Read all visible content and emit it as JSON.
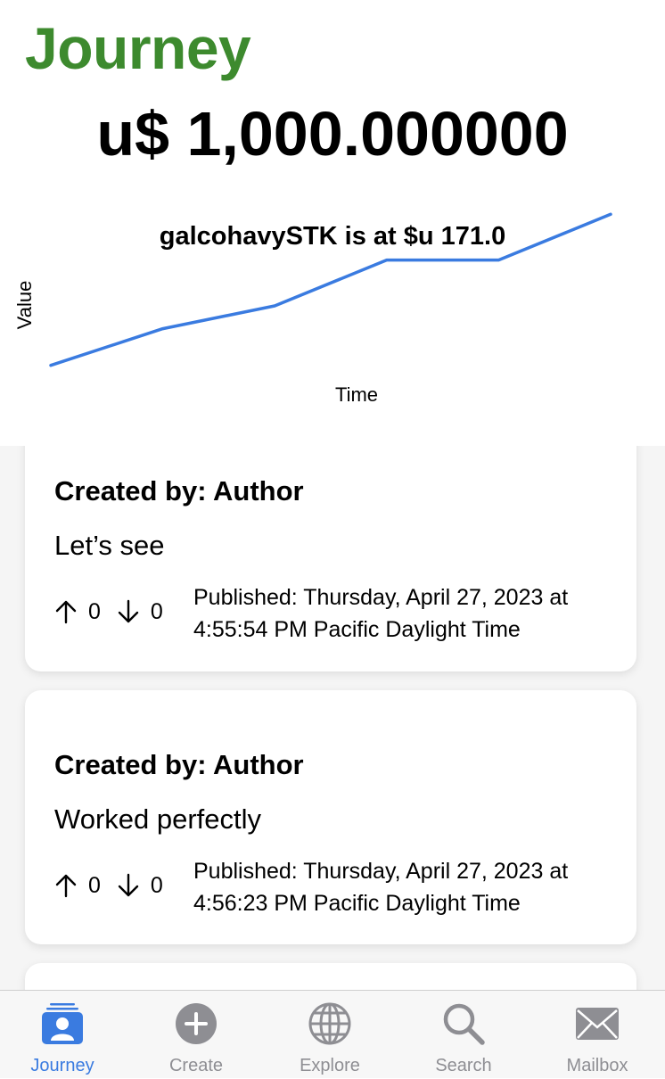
{
  "header": {
    "title": "Journey",
    "balance": "u$ 1,000.000000"
  },
  "chart": {
    "title": "galcohavySTK is at $u 171.0",
    "line_color": "#3a7be0"
  },
  "chart_data": {
    "type": "line",
    "title": "galcohavySTK is at $u 171.0",
    "xlabel": "Time",
    "ylabel": "Value",
    "x": [
      1,
      2,
      3,
      4,
      5,
      6
    ],
    "series": [
      {
        "values": [
          130,
          138,
          143,
          153,
          153,
          163
        ]
      }
    ],
    "ylim": [
      128,
      165
    ],
    "grid": false,
    "color": "#3a7be0"
  },
  "posts": [
    {
      "author": "Created by: Author",
      "body": "Let’s see",
      "upvotes": "0",
      "downvotes": "0",
      "published_line1": "Published: Thursday, April 27, 2023 at",
      "published_line2": "4:55:54 PM Pacific Daylight Time"
    },
    {
      "author": "Created by: Author",
      "body": "Worked perfectly",
      "upvotes": "0",
      "downvotes": "0",
      "published_line1": "Published: Thursday, April 27, 2023 at",
      "published_line2": "4:56:23 PM Pacific Daylight Time"
    }
  ],
  "tabbar": {
    "active_color": "#3a7be0",
    "inactive_color": "#8e8e93",
    "tabs": [
      {
        "label": "Journey",
        "icon": "person-card-icon",
        "active": true
      },
      {
        "label": "Create",
        "icon": "plus-circle-icon",
        "active": false
      },
      {
        "label": "Explore",
        "icon": "globe-icon",
        "active": false
      },
      {
        "label": "Search",
        "icon": "magnifying-glass-icon",
        "active": false
      },
      {
        "label": "Mailbox",
        "icon": "envelope-icon",
        "active": false
      }
    ]
  },
  "colors": {
    "title_green": "#3d8a2e",
    "feed_background": "#f5f5f5"
  }
}
